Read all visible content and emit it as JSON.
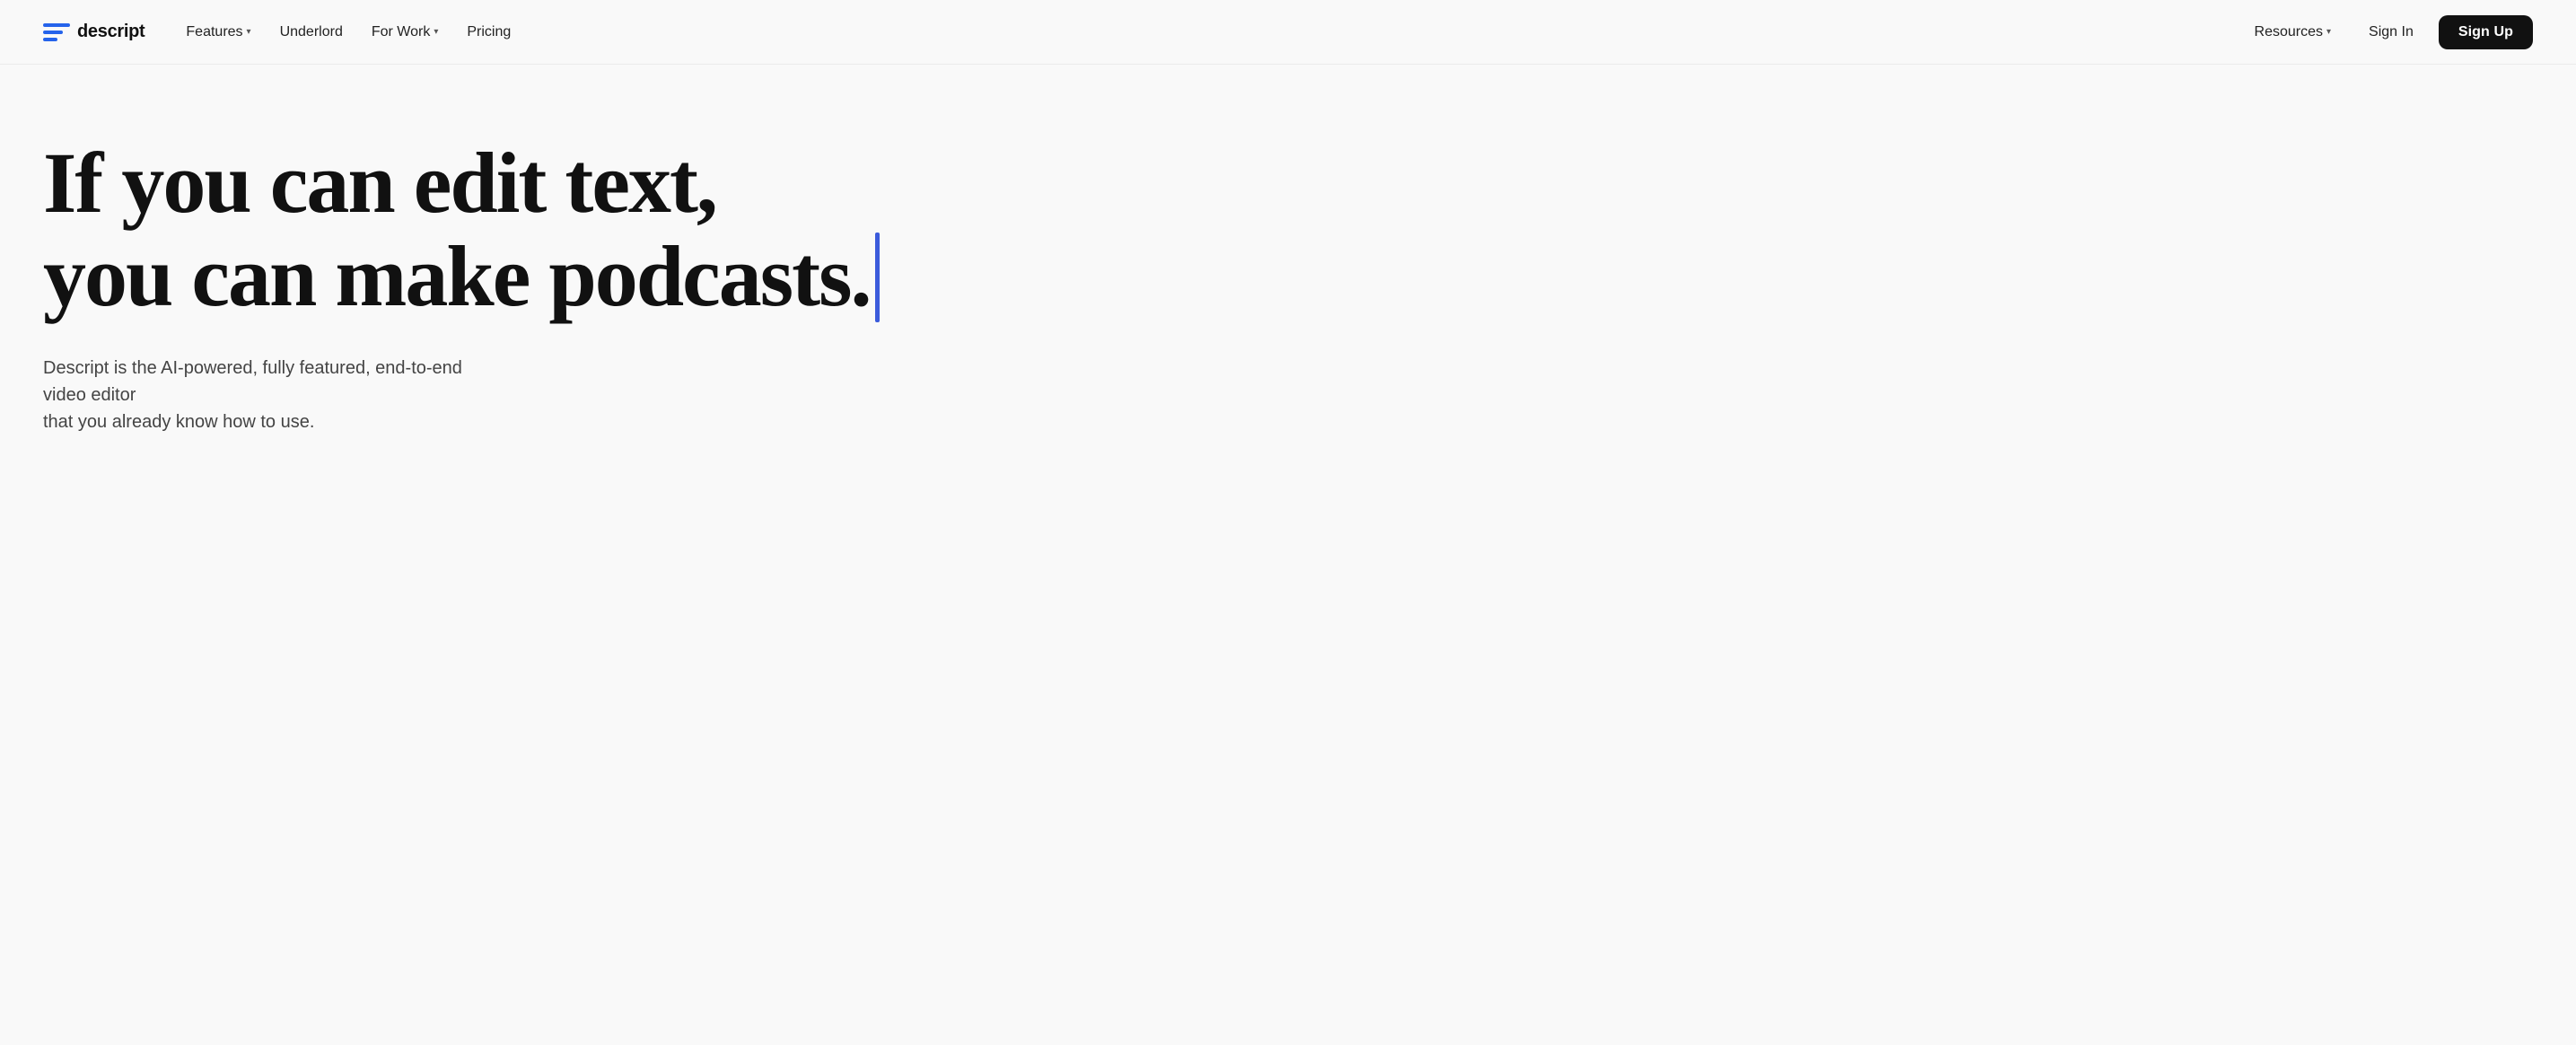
{
  "nav": {
    "logo_text": "descript",
    "links": [
      {
        "label": "Features",
        "has_chevron": true
      },
      {
        "label": "Underlord",
        "has_chevron": false
      },
      {
        "label": "For Work",
        "has_chevron": true
      },
      {
        "label": "Pricing",
        "has_chevron": false
      }
    ],
    "right_links": [
      {
        "label": "Resources",
        "has_chevron": true
      },
      {
        "label": "Sign In",
        "has_chevron": false
      }
    ],
    "signup_label": "Sign Up"
  },
  "hero": {
    "headline_line1": "If you can edit text,",
    "headline_line2": "you can make podcasts.",
    "subtext_line1": "Descript is the AI-powered, fully featured, end-to-end video editor",
    "subtext_line2": "that you already know how to use."
  },
  "colors": {
    "cursor": "#3b5bdb",
    "logo_blue": "#2563eb",
    "btn_bg": "#111111"
  }
}
